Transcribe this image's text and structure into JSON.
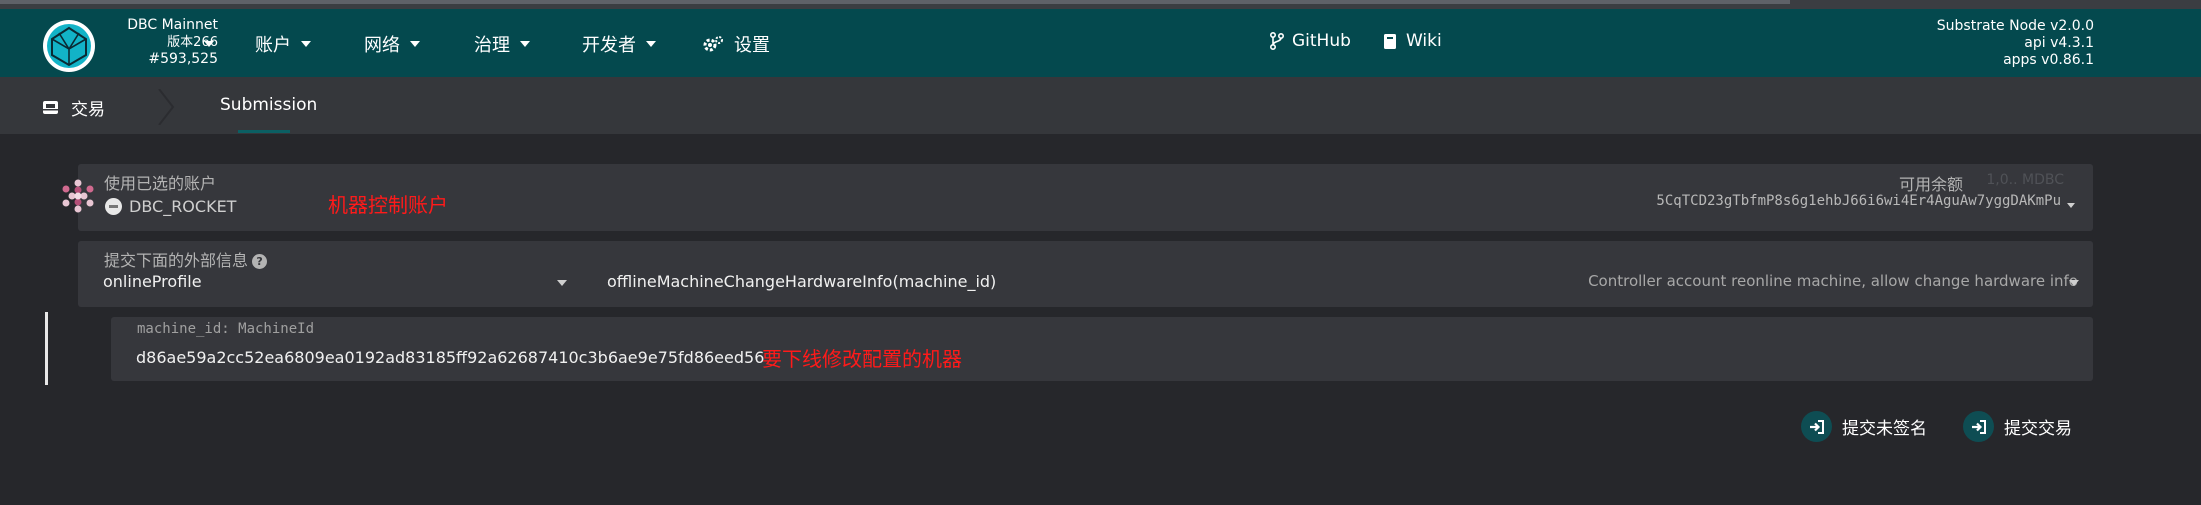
{
  "header": {
    "chain_name": "DBC Mainnet",
    "version": "版本266",
    "block": "#593,525",
    "nav": [
      {
        "label": "账户",
        "icon": "chevron-down-icon"
      },
      {
        "label": "网络",
        "icon": "chevron-down-icon"
      },
      {
        "label": "治理",
        "icon": "chevron-down-icon"
      },
      {
        "label": "开发者",
        "icon": "chevron-down-icon"
      }
    ],
    "settings_label": "设置",
    "github_label": "GitHub",
    "wiki_label": "Wiki",
    "node_info": [
      "Substrate Node v2.0.0",
      "api v4.3.1",
      "apps v0.86.1"
    ]
  },
  "subnav": {
    "tab_extrinsics": "交易",
    "tab_submission": "Submission"
  },
  "account": {
    "label": "使用已选的账户",
    "name": "DBC_ROCKET",
    "note": "机器控制账户",
    "balance_label": "可用余额",
    "balance_value": "1,0..  MDBC",
    "address": "5CqTCD23gTbfmP8s6g1ehbJ66i6wi4Er4AguAw7yggDAKmPu"
  },
  "extrinsic": {
    "label": "提交下面的外部信息",
    "pallet": "onlineProfile",
    "method": "offlineMachineChangeHardwareInfo(machine_id)",
    "description": "Controller account reonline machine, allow change hardware info"
  },
  "param": {
    "label": "machine_id: MachineId",
    "value": "d86ae59a2cc52ea6809ea0192ad83185ff92a62687410c3b6ae9e75fd86eed56",
    "note": "要下线修改配置的机器"
  },
  "actions": {
    "submit_unsigned": "提交未签名",
    "submit": "提交交易"
  },
  "colors": {
    "header_bg": "#04494e",
    "body_bg": "#26272b",
    "panel_bg": "#36373c",
    "annotation_red": "#ff1a1a"
  }
}
